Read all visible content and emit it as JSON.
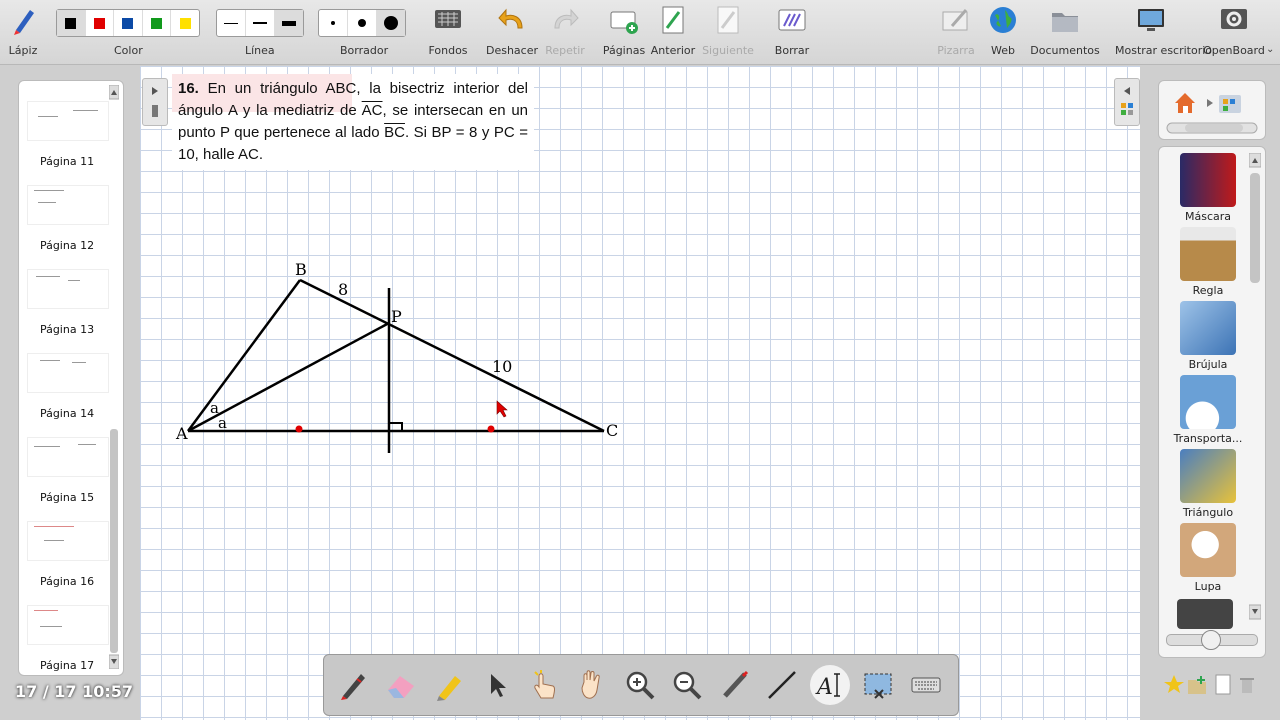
{
  "toolbar": {
    "pencil": "Lápiz",
    "color": "Color",
    "line": "Línea",
    "eraser": "Borrador",
    "backgrounds": "Fondos",
    "undo": "Deshacer",
    "redo": "Repetir",
    "pages": "Páginas",
    "previous": "Anterior",
    "next": "Siguiente",
    "clear": "Borrar",
    "board": "Pizarra",
    "web": "Web",
    "documents": "Documentos",
    "show_desktop": "Mostrar escritorio",
    "openboard": "OpenBoard"
  },
  "colors": [
    "#000000",
    "#e00000",
    "#0b4aa6",
    "#119a1c",
    "#ffe000"
  ],
  "pages": [
    {
      "label": "Página 11"
    },
    {
      "label": "Página 12"
    },
    {
      "label": "Página 13"
    },
    {
      "label": "Página 14"
    },
    {
      "label": "Página 15"
    },
    {
      "label": "Página 16"
    },
    {
      "label": "Página 17"
    }
  ],
  "status": {
    "page_time": "17 / 17 10:57"
  },
  "problem": {
    "number": "16.",
    "t1": " En un triángulo ABC, la bisectriz interior del ángulo A y la mediatriz de ",
    "seg1": "AC",
    "t2": ", se intersecan en un punto P que pertenece al lado ",
    "seg2": "BC",
    "t3": ". Si BP = 8 y PC = 10, halle AC."
  },
  "figure": {
    "A": "A",
    "B": "B",
    "C": "C",
    "P": "P",
    "bp": "8",
    "pc": "10",
    "angle1": "a",
    "angle2": "a"
  },
  "tools": [
    {
      "label": "Máscara",
      "icon": "mask-icon"
    },
    {
      "label": "Regla",
      "icon": "ruler-icon"
    },
    {
      "label": "Brújula",
      "icon": "compass-icon"
    },
    {
      "label": "Transporta...",
      "icon": "protractor-icon"
    },
    {
      "label": "Triángulo",
      "icon": "triangle-ruler-icon"
    },
    {
      "label": "Lupa",
      "icon": "magnifier-icon"
    }
  ]
}
